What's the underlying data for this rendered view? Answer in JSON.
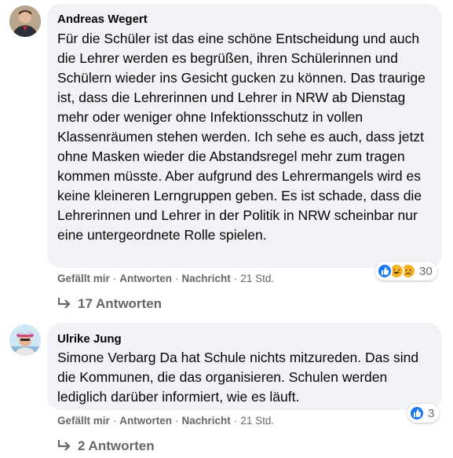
{
  "comments": [
    {
      "author": "Andreas Wegert",
      "text": "Für die Schüler ist das eine schöne Entscheidung und auch die Lehrer werden es begrüßen, ihren Schülerinnen und Schülern wieder ins Gesicht gucken zu können. Das traurige ist, dass die Lehrerinnen und Lehrer in NRW ab Dienstag mehr oder weniger ohne Infektionsschutz in vollen Klassenräumen stehen werden. Ich sehe es auch, dass jetzt ohne Masken wieder die Abstandsregel mehr zum tragen kommen müsste. Aber aufgrund des Lehrermangels wird es keine kleineren Lerngruppen geben. Es ist schade, dass die Lehrerinnen und Lehrer in der Politik in NRW scheinbar nur eine untergeordnete Rolle spielen.",
      "like": "Gefällt mir",
      "reply": "Antworten",
      "message": "Nachricht",
      "time": "21 Std.",
      "reaction_count": "30",
      "reaction_icons": [
        "like-icon",
        "haha-icon",
        "sad-icon"
      ],
      "replies_label": "17 Antworten"
    },
    {
      "author": "Ulrike Jung",
      "text": "Simone Verbarg Da hat Schule nichts mitzureden. Das sind die Kommunen, die das organisieren. Schulen werden lediglich darüber informiert, wie es läuft.",
      "like": "Gefällt mir",
      "reply": "Antworten",
      "message": "Nachricht",
      "time": "21 Std.",
      "reaction_count": "3",
      "reaction_icons": [
        "like-icon"
      ],
      "replies_label": "2 Antworten"
    }
  ],
  "colors": {
    "bubble": "#f0f2f5",
    "meta": "#65676b",
    "like_blue": "#1877f2",
    "emoji_yellow": "#f7b125"
  }
}
